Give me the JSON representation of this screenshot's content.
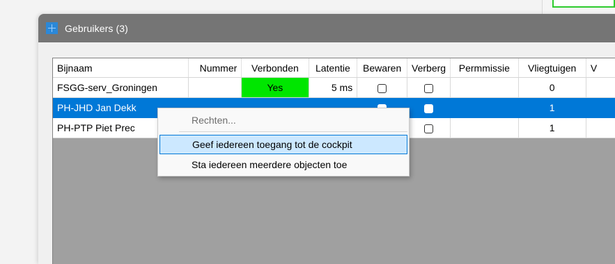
{
  "window": {
    "title": "Gebruikers (3)"
  },
  "table": {
    "columns": [
      "Bijnaam",
      "Nummer",
      "Verbonden",
      "Latentie",
      "Bewaren",
      "Verberg",
      "Permmissie",
      "Vliegtuigen",
      "V"
    ],
    "rows": [
      {
        "bijnaam": "FSGG-serv_Groningen",
        "nummer": "",
        "verbonden": "Yes",
        "latentie": "5 ms",
        "bewaren": false,
        "verberg": false,
        "permissie": "",
        "vliegtuigen": "0",
        "selected": false
      },
      {
        "bijnaam": "PH-JHD  Jan Dekk",
        "nummer": "",
        "verbonden": "",
        "latentie": "",
        "bewaren": false,
        "verberg": false,
        "permissie": "",
        "vliegtuigen": "1",
        "selected": true
      },
      {
        "bijnaam": "PH-PTP  Piet Prec",
        "nummer": "",
        "verbonden": "",
        "latentie": "",
        "bewaren": false,
        "verberg": false,
        "permissie": "",
        "vliegtuigen": "1",
        "selected": false
      }
    ]
  },
  "context_menu": {
    "items": [
      {
        "label": "Rechten...",
        "disabled": true
      },
      {
        "label": "Geef iedereen toegang tot de cockpit",
        "active": true
      },
      {
        "label": "Sta iedereen meerdere objecten toe"
      }
    ]
  },
  "colors": {
    "titlebar": "#757575",
    "selection": "#0078d7",
    "connected": "#00e600",
    "menu_highlight": "#cce8ff"
  }
}
